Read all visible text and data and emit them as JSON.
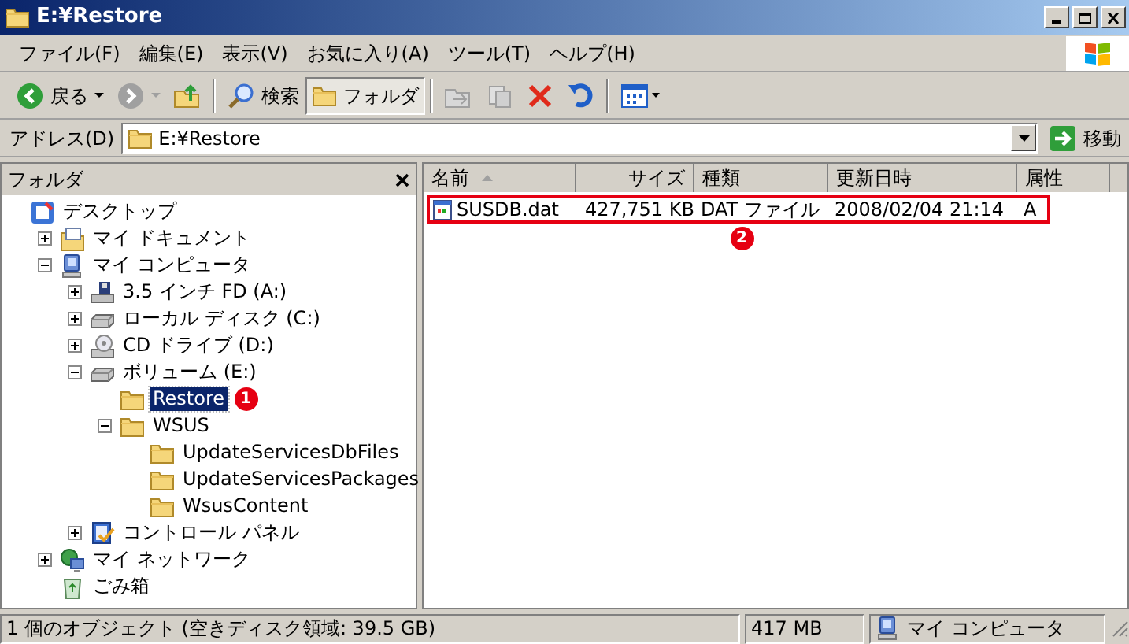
{
  "window": {
    "title": "E:¥Restore"
  },
  "menu": [
    "ファイル(F)",
    "編集(E)",
    "表示(V)",
    "お気に入り(A)",
    "ツール(T)",
    "ヘルプ(H)"
  ],
  "toolbar": [
    {
      "kind": "back",
      "label": "戻る",
      "disabled": false,
      "selected": false
    },
    {
      "kind": "forward",
      "disabled": true,
      "selected": false
    },
    {
      "kind": "up",
      "disabled": false,
      "selected": false
    },
    {
      "kind": "search",
      "label": "検索",
      "disabled": false,
      "selected": false
    },
    {
      "kind": "folders",
      "label": "フォルダ",
      "disabled": false,
      "selected": true
    },
    {
      "kind": "move",
      "disabled": true,
      "selected": false
    },
    {
      "kind": "copy",
      "disabled": true,
      "selected": false
    },
    {
      "kind": "delete",
      "disabled": false,
      "selected": false
    },
    {
      "kind": "undo",
      "disabled": false,
      "selected": false
    },
    {
      "kind": "views",
      "disabled": false,
      "selected": false
    }
  ],
  "address": {
    "label": "アドレス(D)",
    "value": "E:¥Restore",
    "go": "移動"
  },
  "folders_pane": {
    "title": "フォルダ",
    "tree": [
      {
        "kind": "desktop",
        "label": "デスクトップ",
        "selected": false,
        "children": [
          {
            "kind": "documents",
            "label": "マイ ドキュメント",
            "selected": false,
            "expanded": false
          },
          {
            "kind": "computer",
            "label": "マイ コンピュータ",
            "selected": false,
            "expanded": true,
            "children": [
              {
                "kind": "floppy",
                "label": "3.5 インチ FD (A:)",
                "selected": false,
                "expanded": false
              },
              {
                "kind": "disk",
                "label": "ローカル ディスク (C:)",
                "selected": false,
                "expanded": false
              },
              {
                "kind": "cd",
                "label": "CD ドライブ (D:)",
                "selected": false,
                "expanded": false
              },
              {
                "kind": "disk",
                "label": "ボリューム (E:)",
                "selected": false,
                "expanded": true,
                "children": [
                  {
                    "kind": "folder",
                    "label": "Restore",
                    "selected": true,
                    "badge": "1"
                  },
                  {
                    "kind": "folder",
                    "label": "WSUS",
                    "selected": false,
                    "expanded": true,
                    "children": [
                      {
                        "kind": "folder",
                        "label": "UpdateServicesDbFiles",
                        "selected": false
                      },
                      {
                        "kind": "folder",
                        "label": "UpdateServicesPackages",
                        "selected": false
                      },
                      {
                        "kind": "folder",
                        "label": "WsusContent",
                        "selected": false
                      }
                    ]
                  }
                ]
              },
              {
                "kind": "control",
                "label": "コントロール パネル",
                "selected": false,
                "expanded": false
              }
            ]
          },
          {
            "kind": "network",
            "label": "マイ ネットワーク",
            "selected": false,
            "expanded": false
          },
          {
            "kind": "trash",
            "label": "ごみ箱",
            "selected": false
          }
        ]
      }
    ]
  },
  "files": {
    "columns": [
      {
        "label": "名前",
        "sorted": true
      },
      {
        "label": "サイズ",
        "sorted": false
      },
      {
        "label": "種類",
        "sorted": false
      },
      {
        "label": "更新日時",
        "sorted": false
      },
      {
        "label": "属性",
        "sorted": false
      }
    ],
    "rows": [
      {
        "cells": [
          "SUSDB.dat",
          "427,751 KB",
          "DAT ファイル",
          "2008/02/04 21:14",
          "A"
        ],
        "highlighted": true,
        "badge": "2"
      }
    ]
  },
  "status_bar": {
    "text": "1 個のオブジェクト (空きディスク領域: 39.5 GB)",
    "size": "417 MB",
    "zone": "マイ コンピュータ"
  }
}
